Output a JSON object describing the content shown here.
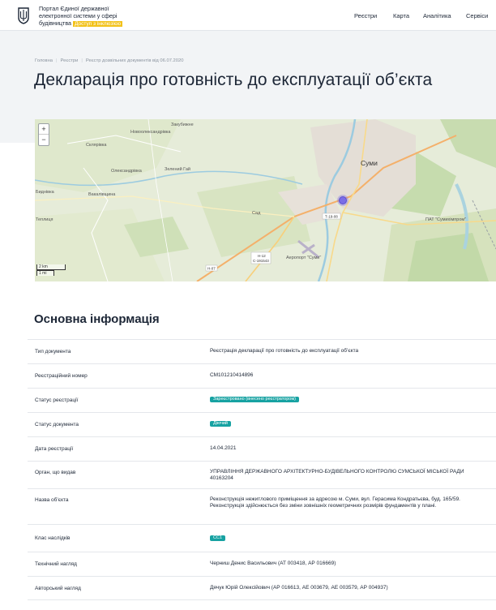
{
  "header": {
    "portal_line1": "Портал Єдиної державної",
    "portal_line2": "електронної системи у сфері",
    "portal_line3": "будівництва",
    "access_badge": "Доступ з інклюзією",
    "nav": [
      "Реєстри",
      "Карта",
      "Аналітика",
      "Сервіси"
    ]
  },
  "breadcrumb": [
    "Головна",
    "Реєстри",
    "Реєстр дозвільних документів від 06.07.2020"
  ],
  "page_title": "Декларація про готовність до експлуатації об’єкта",
  "map": {
    "zoom_in": "+",
    "zoom_out": "−",
    "scale_km": "2 km",
    "scale_mi": "1 mi",
    "places": [
      "Закубижне",
      "Новоолександрівка",
      "Склярівка",
      "Олександрівка",
      "Зелений Гай",
      "Суми",
      "Биднівка",
      "Вакалівщина",
      "Теплиця",
      "Сад",
      "Аеропорт \"Суми\"",
      "ПАТ \"Сумихімпром\""
    ],
    "roads": [
      "Т-19-08",
      "Н-12",
      "С-191543",
      "Н-07"
    ],
    "colors": {
      "marker": "#7b6ee6",
      "land": "#dfe7cf",
      "water": "#aad3df",
      "urban": "#e3ddd6"
    }
  },
  "section_title": "Основна інформація",
  "info": {
    "doc_type": {
      "label": "Тип документа",
      "value": "Реєстрація декларації про готовність до експлуатації об’єкта"
    },
    "reg_number": {
      "label": "Реєстраційний номер",
      "value": "СМ101210414896"
    },
    "reg_status": {
      "label": "Статус реєстрації",
      "value": "Зареєстровано (внесено реєстратором)"
    },
    "doc_status": {
      "label": "Статус документа",
      "value": "Діючий"
    },
    "reg_date": {
      "label": "Дата реєстрації",
      "value": "14.04.2021"
    },
    "issuer": {
      "label": "Орган, що видав",
      "value": "УПРАВЛІННЯ ДЕРЖАВНОГО АРХІТЕКТУРНО-БУДІВЕЛЬНОГО КОНТРОЛЮ СУМСЬКОЇ МІСЬКОЇ РАДИ 40163204"
    },
    "object_name": {
      "label": "Назва об’єкта",
      "value": "Реконструкція нежитлового приміщення за адресою м. Суми, вул. Герасима Кондратьєва, буд. 165/59. Реконструкція здійснюється без зміни зовнішніх геометричних розмірів фундаментів у плані."
    },
    "consequence_class": {
      "label": "Клас наслідків",
      "value": "СС1"
    },
    "tech_supervision": {
      "label": "Технічний нагляд",
      "value": "Черниш Денис Васильович (АТ 003418, АР 016669)"
    },
    "author_supervision": {
      "label": "Авторський нагляд",
      "value": "Дячук Юрій Олексійович (АР 016613, АЕ 003679, АЕ 003579, АР 004937)"
    }
  },
  "colors": {
    "accent_teal": "#17a2a2",
    "badge_yellow": "#f2c21b",
    "band": "#f2f4f6"
  }
}
